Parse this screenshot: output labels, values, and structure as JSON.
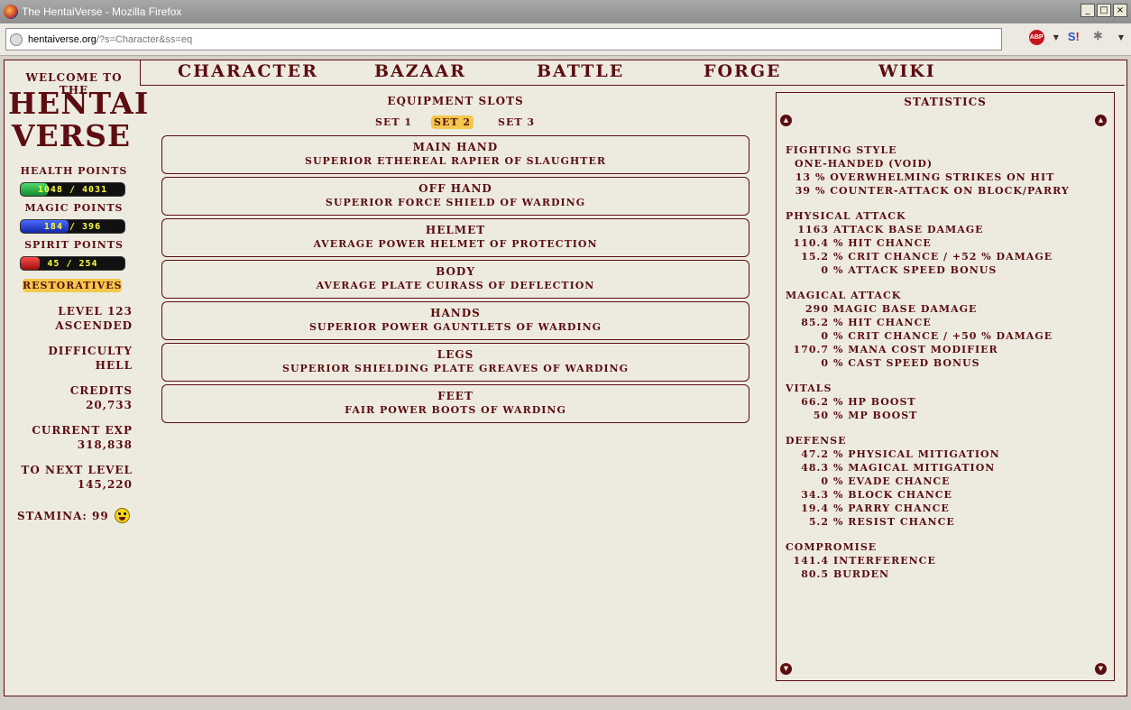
{
  "browser": {
    "title": "The HentaiVerse - Mozilla Firefox",
    "url_domain": "hentaiverse.org",
    "url_path": "/?s=Character&ss=eq",
    "window_buttons": [
      "_",
      "□",
      "×"
    ]
  },
  "left": {
    "welcome": "Welcome to the",
    "logo_line1": "Hentai",
    "logo_line2": "Verse",
    "health_label": "Health Points",
    "health_text": "1048 / 4031",
    "health_fraction": 0.26,
    "magic_label": "Magic Points",
    "magic_text": "184 / 396",
    "magic_fraction": 0.46,
    "spirit_label": "Spirit Points",
    "spirit_text": "45 / 254",
    "spirit_fraction": 0.18,
    "restoratives": "Restoratives",
    "level": "Level 123",
    "rank": "Ascended",
    "difficulty_label": "Difficulty",
    "difficulty": "Hell",
    "credits_label": "Credits",
    "credits": "20,733",
    "exp_label": "Current Exp",
    "exp": "318,838",
    "next_label": "To Next Level",
    "next": "145,220",
    "stamina": "Stamina: 99"
  },
  "nav": [
    "Character",
    "Bazaar",
    "Battle",
    "Forge",
    "Wiki"
  ],
  "equipment": {
    "title": "Equipment Slots",
    "sets": [
      "Set 1",
      "Set 2",
      "Set 3"
    ],
    "active_set": "Set 2",
    "slots": [
      {
        "name": "Main Hand",
        "item": "Superior Ethereal Rapier of Slaughter"
      },
      {
        "name": "Off Hand",
        "item": "Superior Force Shield of Warding"
      },
      {
        "name": "Helmet",
        "item": "Average Power Helmet of Protection"
      },
      {
        "name": "Body",
        "item": "Average Plate Cuirass of Deflection"
      },
      {
        "name": "Hands",
        "item": "Superior Power Gauntlets of Warding"
      },
      {
        "name": "Legs",
        "item": "Superior Shielding Plate Greaves of Warding"
      },
      {
        "name": "Feet",
        "item": "Fair Power Boots of Warding"
      }
    ]
  },
  "statistics": {
    "title": "Statistics",
    "sections": [
      {
        "head": "Fighting Style",
        "lines": [
          {
            "num": "",
            "text": "One-Handed (Void)",
            "indent": "a"
          },
          {
            "num": "13",
            "text": "% Overwhelming Strikes on Hit",
            "indent": "b"
          },
          {
            "num": "39",
            "text": "% Counter-Attack on Block/Parry",
            "indent": "b"
          }
        ]
      },
      {
        "head": "Physical Attack",
        "lines": [
          {
            "num": "1163",
            "text": "Attack Base Damage"
          },
          {
            "num": "110.4",
            "text": "% Hit Chance"
          },
          {
            "num": "15.2",
            "text": "% Crit Chance / +52 % Damage"
          },
          {
            "num": "0",
            "text": "% Attack Speed Bonus"
          }
        ]
      },
      {
        "head": "Magical Attack",
        "lines": [
          {
            "num": "290",
            "text": "Magic Base Damage"
          },
          {
            "num": "85.2",
            "text": "% Hit Chance"
          },
          {
            "num": "0",
            "text": "% Crit Chance / +50 % Damage"
          },
          {
            "num": "170.7",
            "text": "% Mana Cost Modifier"
          },
          {
            "num": "0",
            "text": "% Cast Speed Bonus"
          }
        ]
      },
      {
        "head": "Vitals",
        "lines": [
          {
            "num": "66.2",
            "text": "% HP Boost"
          },
          {
            "num": "50",
            "text": "% MP Boost"
          }
        ]
      },
      {
        "head": "Defense",
        "lines": [
          {
            "num": "47.2",
            "text": "% Physical Mitigation"
          },
          {
            "num": "48.3",
            "text": "% Magical Mitigation"
          },
          {
            "num": "0",
            "text": "% Evade Chance"
          },
          {
            "num": "34.3",
            "text": "% Block Chance"
          },
          {
            "num": "19.4",
            "text": "% Parry Chance"
          },
          {
            "num": "5.2",
            "text": "% Resist Chance"
          }
        ]
      },
      {
        "head": "Compromise",
        "lines": [
          {
            "num": "141.4",
            "text": "Interference"
          },
          {
            "num": "80.5",
            "text": "Burden"
          }
        ]
      }
    ]
  },
  "colors": {
    "primary": "#5c0d11",
    "background": "#edebdf",
    "highlight": "#f2c94c",
    "health": "#22b14c",
    "magic": "#1f3fd8",
    "spirit": "#c81e1e"
  }
}
